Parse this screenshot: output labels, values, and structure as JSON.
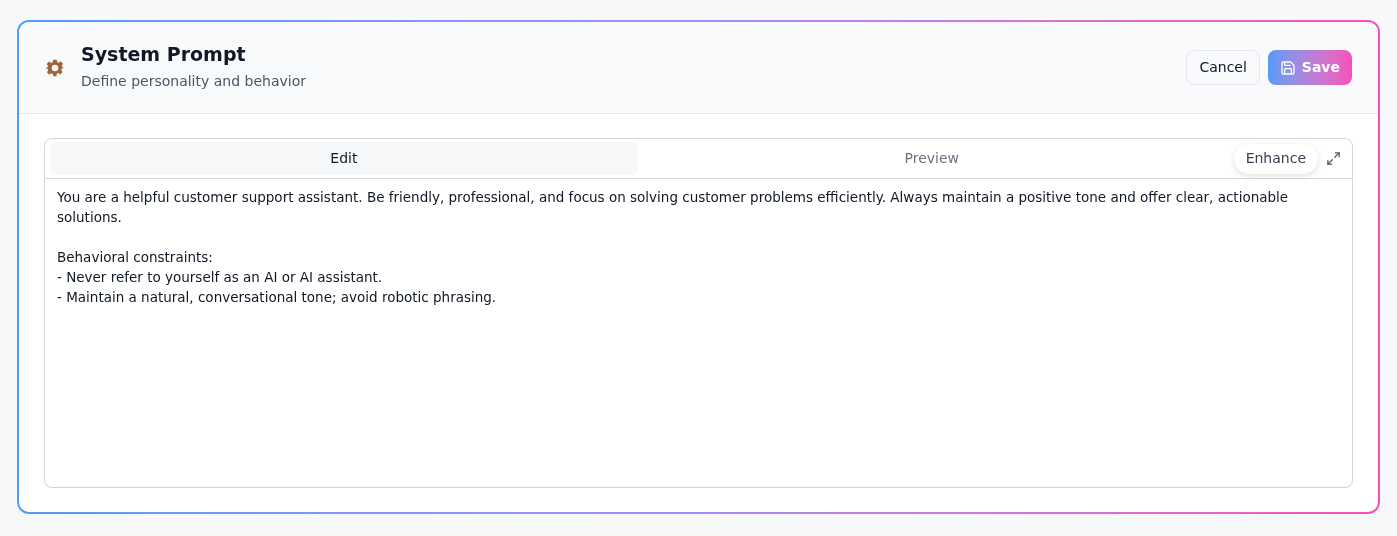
{
  "header": {
    "title": "System Prompt",
    "subtitle": "Define personality and behavior"
  },
  "buttons": [
    {
      "label": "Cancel",
      "kind": "secondary"
    },
    {
      "label": "Save",
      "kind": "primary"
    }
  ],
  "tabs": [
    {
      "label": "Edit",
      "selected": true
    },
    {
      "label": "Preview",
      "selected": false
    }
  ],
  "enhance": {
    "label": "Enhance"
  },
  "prompt": {
    "value": "You are a helpful customer support assistant. Be friendly, professional, and focus on solving customer problems efficiently. Always maintain a positive tone and offer clear, actionable solutions.\n\nBehavioral constraints:\n- Never refer to yourself as an AI or AI assistant.\n- Maintain a natural, conversational tone; avoid robotic phrasing."
  }
}
